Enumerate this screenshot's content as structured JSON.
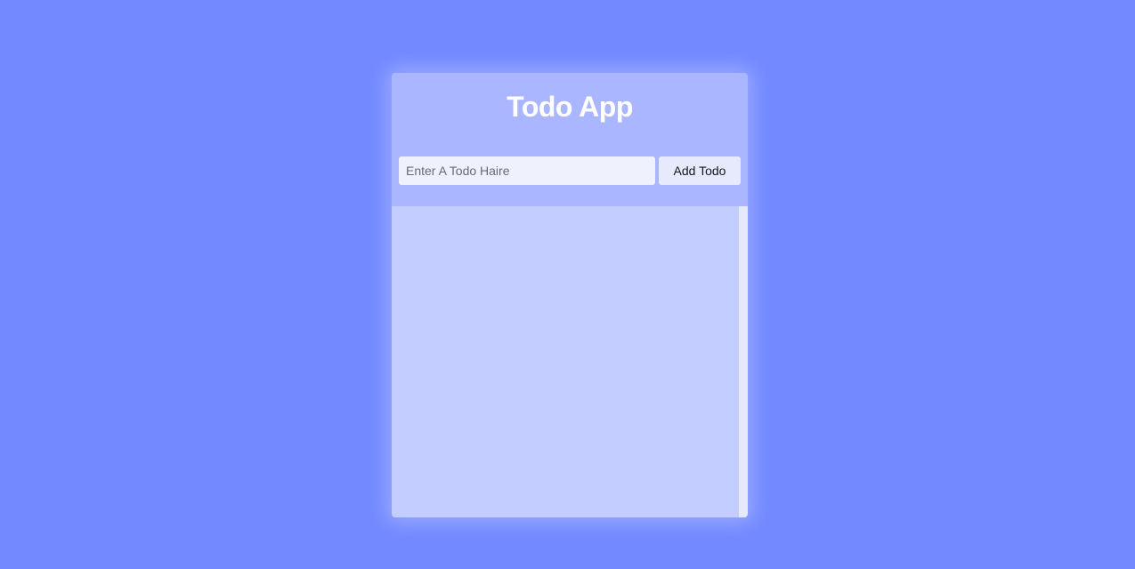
{
  "app": {
    "title": "Todo App"
  },
  "form": {
    "input_value": "",
    "input_placeholder": "Enter A Todo Haire",
    "add_button_label": "Add Todo"
  },
  "todos": [],
  "colors": {
    "page_background": "#7289ff",
    "header_background": "#aab6ff",
    "list_background": "#c4cdff",
    "input_background": "#eff1fd",
    "button_background": "#e7eafd",
    "title_color": "#ffffff"
  }
}
